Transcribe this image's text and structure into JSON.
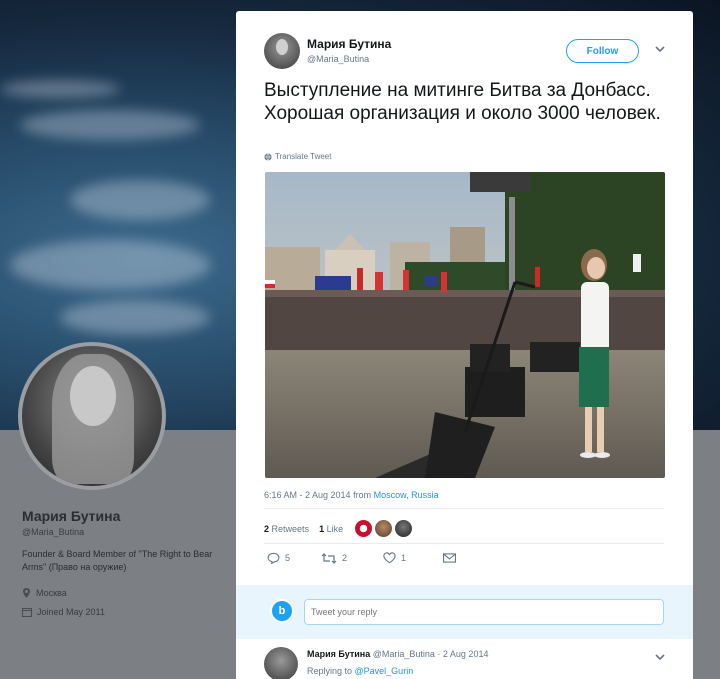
{
  "profile": {
    "name": "Мария Бутина",
    "handle": "@Maria_Butina",
    "bio": "Founder & Board Member of \"The Right to Bear Arms\" (Право на оружие)",
    "location": "Москва",
    "joined": "Joined May 2011"
  },
  "tweet": {
    "author_name": "Мария Бутина",
    "author_handle": "@Maria_Butina",
    "follow_label": "Follow",
    "text": "Выступление на митинге Битва за Донбасс. Хорошая организация и около 3000 человек.",
    "translate_label": "Translate Tweet",
    "time": "6:16 AM - 2 Aug 2014 from ",
    "location": "Moscow, Russia",
    "retweets_count": "2",
    "retweets_label": "Retweets",
    "likes_count": "1",
    "likes_label": "Like",
    "actions": {
      "replies": "5",
      "retweets": "2",
      "likes": "1"
    },
    "colors": {
      "accent": "#1da1f2",
      "like_red": "#e0245e"
    }
  },
  "reply": {
    "placeholder": "Tweet your reply"
  },
  "reply_tweet": {
    "author_name": "Мария Бутина",
    "meta": " @Maria_Butina · 2 Aug 2014",
    "replying_prefix": "Replying to ",
    "replying_to": "@Pavel_Gurin"
  }
}
